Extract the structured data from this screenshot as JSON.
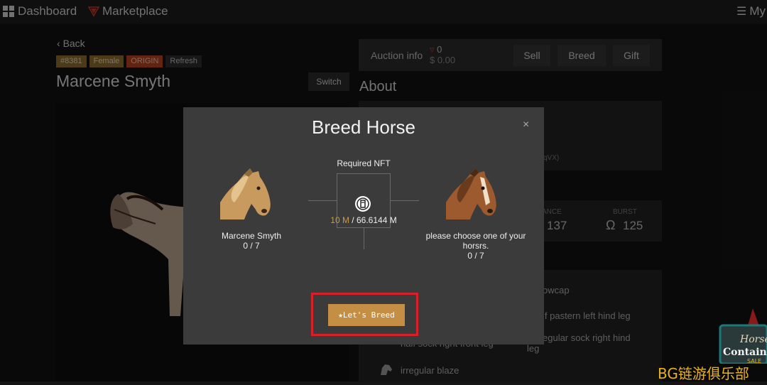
{
  "topbar": {
    "dashboard_label": "Dashboard",
    "marketplace_label": "Marketplace",
    "my_label": "My"
  },
  "profile": {
    "back_label": "Back",
    "tags": [
      "#8381",
      "Female",
      "ORIGIN",
      "Refresh"
    ],
    "name": "Marcene Smyth",
    "switch_label": "Switch"
  },
  "auction": {
    "label": "Auction info",
    "price": "0",
    "usd": "$ 0.00",
    "sell_label": "Sell",
    "breed_label": "Breed",
    "gift_label": "Gift"
  },
  "about": {
    "title": "About",
    "address_fragment": "qVX)"
  },
  "stats": {
    "stamina_label": "ANCE",
    "stamina_value": "137",
    "burst_label": "BURST",
    "burst_value": "125"
  },
  "traits": [
    "owcap",
    "lf pastern left hind leg",
    "egular sock right hind",
    "leg",
    "half sock right front leg",
    "irregular blaze"
  ],
  "modal": {
    "title": "Breed Horse",
    "close_glyph": "×",
    "required_nft_label": "Required NFT",
    "nft_required": "10 M",
    "nft_separator": " / ",
    "nft_owned": "66.6144 M",
    "left_horse_name": "Marcene Smyth",
    "left_horse_count": "0 / 7",
    "right_prompt": "please choose one of your horsrs.",
    "right_count": "0 / 7",
    "breed_button_label": "★Let's Breed"
  },
  "watermark": "BG链游俱乐部",
  "promo_text": "Horse Contain SALE",
  "colors": {
    "accent": "#c48f45",
    "highlight": "#d9202a",
    "modal_bg": "#3b3b3b"
  }
}
